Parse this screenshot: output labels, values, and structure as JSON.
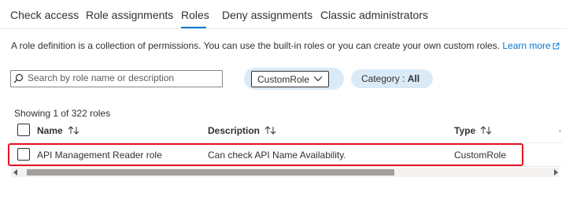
{
  "tabs": [
    {
      "label": "Check access"
    },
    {
      "label": "Role assignments"
    },
    {
      "label": "Roles",
      "active": true
    },
    {
      "label": "Deny assignments"
    },
    {
      "label": "Classic administrators"
    }
  ],
  "description": {
    "text": "A role definition is a collection of permissions. You can use the built-in roles or you can create your own custom roles.",
    "link": "Learn more"
  },
  "search": {
    "placeholder": "Search by role name or description",
    "value": ""
  },
  "type_filter": {
    "value": "CustomRole"
  },
  "category_filter": {
    "label": "Category :",
    "value": "All"
  },
  "results": {
    "showing": "Showing 1 of 322 roles"
  },
  "table": {
    "columns": [
      {
        "label": "Name"
      },
      {
        "label": "Description"
      },
      {
        "label": "Type"
      }
    ],
    "rows": [
      {
        "name": "API Management Reader role",
        "description": "Can check API Name Availability.",
        "type": "CustomRole"
      }
    ]
  },
  "colors": {
    "accent": "#0078d4",
    "highlight": "#e81123",
    "pill": "#dbeaf7"
  },
  "icons": {
    "search": "search-icon",
    "external": "external-link-icon",
    "dropdown": "chevron-down-icon",
    "sort": "sort-icon",
    "scroll_left": "scroll-left-icon",
    "scroll_right": "scroll-right-icon"
  }
}
